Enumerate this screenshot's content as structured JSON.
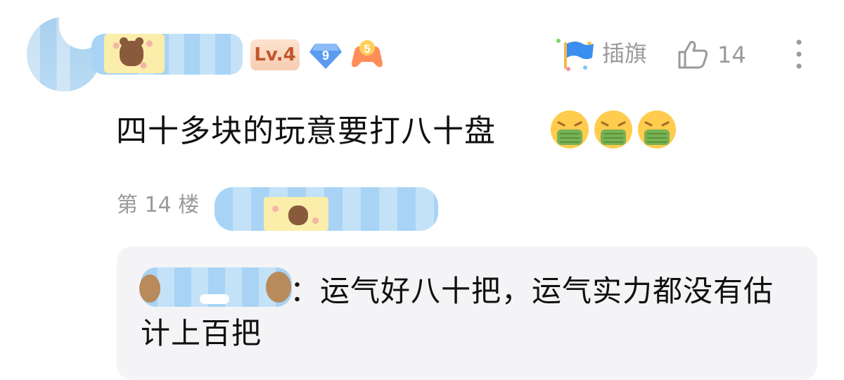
{
  "comment": {
    "level_badge": "Lv.4",
    "diamond_badge": "9",
    "game_badge": "5",
    "flag_label": "插旗",
    "like_count": "14",
    "text": "四十多块的玩意要打八十盘",
    "emojis": [
      "sick-face-emoji",
      "sick-face-emoji",
      "sick-face-emoji"
    ],
    "floor_label": "第 14 楼"
  },
  "reply": {
    "text": "：运气好八十把，运气实力都没有估计上百把"
  },
  "colors": {
    "level_badge_bg": "#f7cdb2",
    "level_badge_text": "#c1562c",
    "diamond": "#5b9bf0",
    "meta_gray": "#9a9a9a",
    "reply_bg": "#f4f4f6"
  }
}
